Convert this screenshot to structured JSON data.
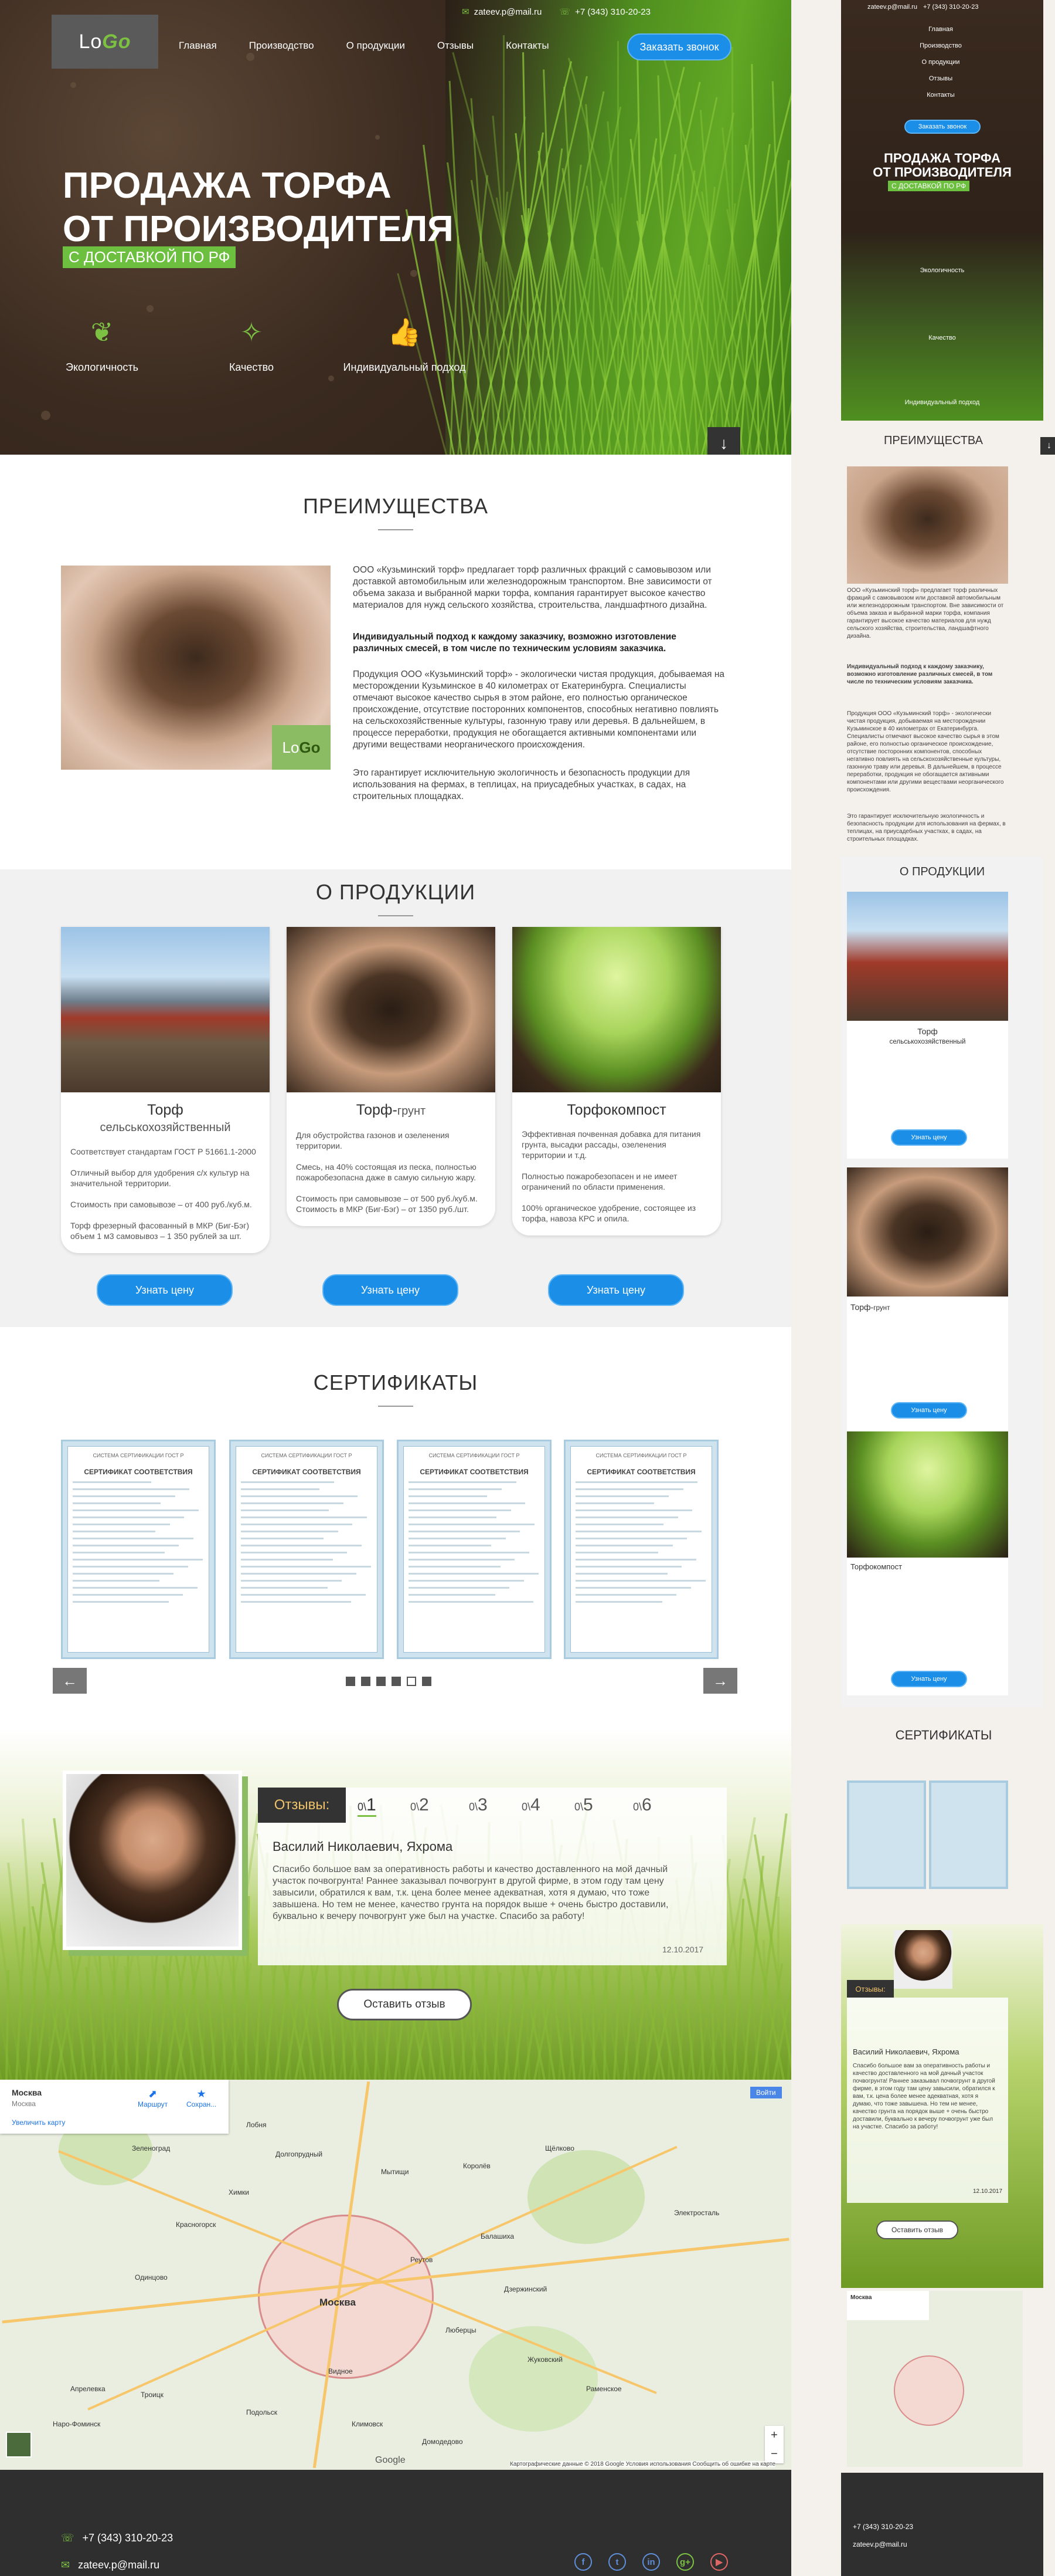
{
  "header": {
    "email": "zateev.p@mail.ru",
    "phone": "+7 (343) 310-20-23",
    "logo_a": "Lo",
    "logo_b": "Go",
    "nav": [
      "Главная",
      "Производство",
      "О продукции",
      "Отзывы",
      "Контакты"
    ],
    "callback": "Заказать звонок"
  },
  "hero": {
    "title1": "ПРОДАЖА ТОРФА",
    "title2": "ОТ ПРОИЗВОДИТЕЛЯ",
    "subtitle": "С ДОСТАВКОЙ ПО РФ",
    "features": [
      "Экологичность",
      "Качество",
      "Индивидуальный подход"
    ]
  },
  "advantages": {
    "title": "ПРЕИМУЩЕСТВА",
    "p1": "ООО «Кузьминский торф» предлагает торф различных фракций с самовывозом или доставкой автомобильным или железнодорожным транспортом. Вне зависимости от объема заказа и выбранной марки торфа, компания гарантирует высокое качество материалов для нужд сельского хозяйства, строительства, ландшафтного дизайна.",
    "p2": "Индивидуальный подход к каждому заказчику, возможно изготовление различных смесей, в том числе по техническим условиям заказчика.",
    "p3": "Продукция ООО «Кузьминский торф» - экологически чистая продукция, добываемая на месторождении Кузьминское в 40 километрах от Екатеринбурга. Специалисты отмечают высокое качество сырья в этом районе, его полностью органическое происхождение, отсутствие посторонних компонентов, способных негативно повлиять на сельскохозяйственные культуры, газонную траву или деревья. В дальнейшем, в процессе переработки, продукция не обогащается активными компонентами или другими веществами неорганического происхождения.",
    "p4": "Это гарантирует исключительную экологичность и безопасность продукции для использования на фермах, в теплицах, на приусадебных участках, в садах, на строительных площадках."
  },
  "products": {
    "title": "О ПРОДУКЦИИ",
    "price_label": "Узнать цену",
    "items": [
      {
        "name": "Торф",
        "sub": "сельськохозяйственный",
        "desc": "Соответствует стандартам ГОСТ Р 51661.1-2000\n\nОтличный выбор для удобрения с/х культур на значительной территории.\n\nСтоимость при самовывозе – от 400 руб./куб.м.\n\nТорф фрезерный фасованный в МКР (Биг-Бэг) объем 1 м3 самовывоз – 1 350 рублей за шт."
      },
      {
        "name": "Торф-",
        "sub": "грунт",
        "desc": "Для обустройства газонов и озеленения территории.\n\nСмесь, на 40% состоящая из песка, полностью пожаробезопасна даже в самую сильную жару.\n\nСтоимость при самовывозе – от 500 руб./куб.м.\nСтоимость в МКР (Биг-Бэг) – от 1350 руб./шт."
      },
      {
        "name": "Торфокомпост",
        "sub": "",
        "desc": "Эффективная почвенная добавка для питания грунта, высадки рассады, озеленения территории и т.д.\n\nПолностью пожаробезопасен и не имеет ограничений по области применения.\n\n100% органическое удобрение, состоящее из торфа, навоза КРС и опила."
      }
    ]
  },
  "certificates": {
    "title": "СЕРТИФИКАТЫ",
    "header": "СИСТЕМА СЕРТИФИКАЦИИ ГОСТ Р",
    "name": "СЕРТИФИКАТ СООТВЕТСТВИЯ",
    "prev": "←",
    "next": "→"
  },
  "reviews": {
    "label": "Отзывы:",
    "tabs": [
      "1",
      "2",
      "3",
      "4",
      "5",
      "6"
    ],
    "author": "Василий Николаевич, Яхрома",
    "text": "Спасибо большое вам за оперативность работы и качество доставленного на мой дачный участок почвогрунта! Раннее заказывал почвогрунт в другой фирме, в этом году там цену завысили, обратился к вам, т.к. цена более менее адекватная, хотя я думаю, что тоже завышена. Но тем не менее, качество грунта на порядок выше + очень быстро доставили, буквально к вечеру почвогрунт уже был на участке. Спасибо за работу!",
    "date": "12.10.2017",
    "button": "Оставить отзыв"
  },
  "map": {
    "city": "Москва",
    "region": "Москва",
    "enlarge": "Увеличить карту",
    "route": "Маршрут",
    "save": "Сохран...",
    "open": "Войти",
    "places": [
      "Москва",
      "Зеленоград",
      "Химки",
      "Мытищи",
      "Королёв",
      "Балашиха",
      "Люберцы",
      "Подольск",
      "Одинцово",
      "Красногорск",
      "Щёлково",
      "Видное",
      "Домодедово",
      "Дзержинский",
      "Реутов",
      "Лобня",
      "Долгопрудный",
      "Электросталь",
      "Раменское",
      "Жуковский",
      "Троицк",
      "Климовск",
      "Наро-Фоминск",
      "Апрелевка"
    ],
    "copyright": "Картографические данные © 2018 Google   Условия использования   Сообщить об ошибке на карте",
    "google": "Google"
  },
  "footer": {
    "phone": "+7 (343) 310-20-23",
    "email": "zateev.p@mail.ru",
    "social": [
      "f",
      "t",
      "in",
      "g+",
      "▶"
    ]
  },
  "mobile": {
    "nav": [
      "Главная",
      "Производство",
      "О продукции",
      "Отзывы",
      "Контакты"
    ]
  }
}
